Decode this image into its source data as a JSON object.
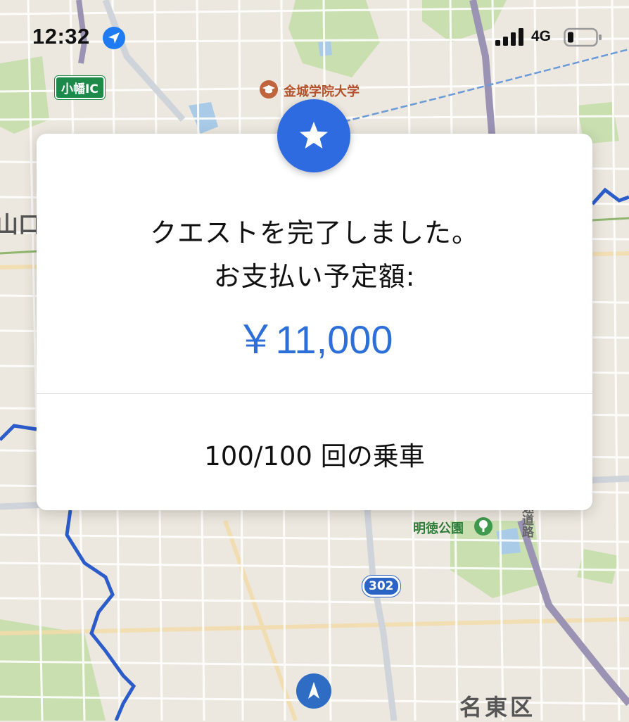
{
  "status_bar": {
    "time": "12:32",
    "network": "4G",
    "icons": [
      "location-arrow-icon",
      "signal-bars-icon",
      "battery-icon"
    ]
  },
  "map": {
    "labels": {
      "interchange": "小幡IC",
      "university": "金城学院大学",
      "park": "明徳公園",
      "route_number": "302",
      "ward": "名東区",
      "partial_left": "山口",
      "highway": "速道路"
    },
    "icons": [
      "graduation-cap-icon",
      "park-tree-icon",
      "navigation-arrow-icon"
    ]
  },
  "dialog": {
    "icon": "star-icon",
    "message_line1": "クエストを完了しました。",
    "message_line2": "お支払い予定額:",
    "amount": "￥11,000",
    "rides": "100/100 回の乗車"
  },
  "colors": {
    "accent_blue": "#2f6be0",
    "amount_blue": "#2d6fd8",
    "map_background": "#ece8df",
    "park_green": "#c9dfb0",
    "route_blue": "#2b5cc9"
  }
}
